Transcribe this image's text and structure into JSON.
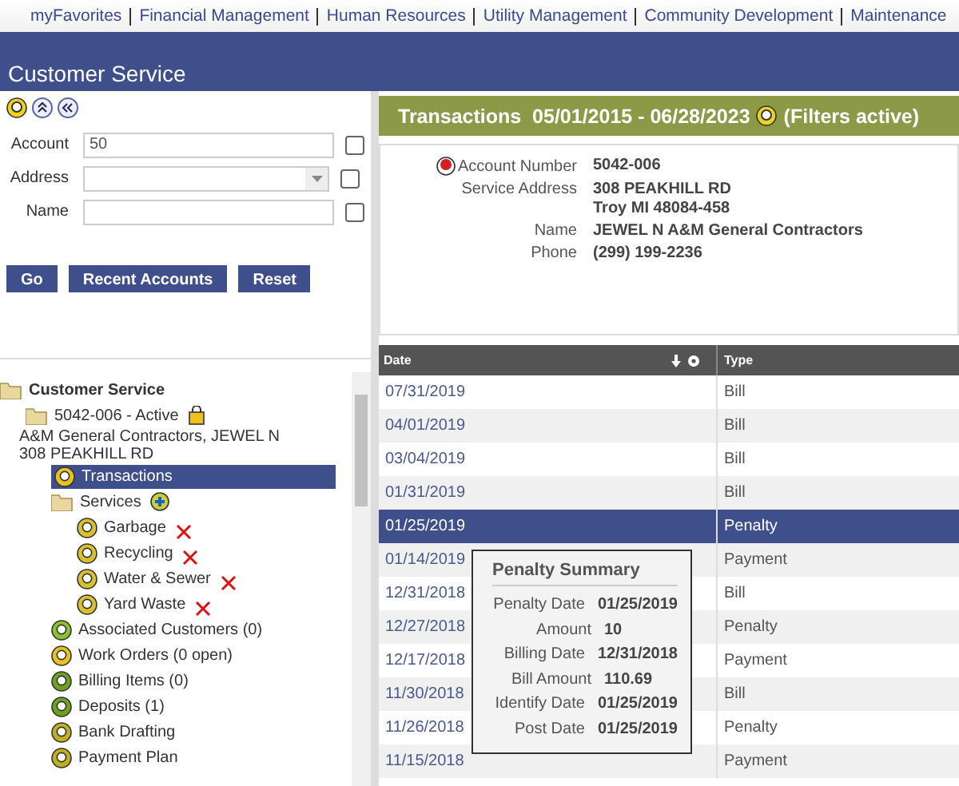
{
  "nav": [
    "myFavorites",
    "Financial Management",
    "Human Resources",
    "Utility Management",
    "Community Development",
    "Maintenance"
  ],
  "header": {
    "title": "Customer Service"
  },
  "search": {
    "fields": [
      {
        "label": "Account",
        "value": "50",
        "kind": "text",
        "checked": false
      },
      {
        "label": "Address",
        "kind": "dropdown",
        "checked": false
      },
      {
        "label": "Name",
        "kind": "text",
        "checked": false
      }
    ],
    "buttons": [
      "Go",
      "Recent Accounts",
      "Reset"
    ]
  },
  "tree": [
    {
      "label": "Customer Service",
      "kind": "folder",
      "selected": false,
      "children": [
        {
          "label": "5042-006 - Active",
          "kind": "account",
          "selected": false,
          "lines": [
            "A&M General Contractors, JEWEL N",
            "308 PEAKHILL RD"
          ],
          "children": [
            {
              "label": "Transactions",
              "kind": "search",
              "selected": true
            },
            {
              "label": "Services",
              "kind": "services",
              "selected": false,
              "children": [
                {
                  "label": "Garbage",
                  "kind": "service",
                  "selected": false,
                  "flagged": true
                },
                {
                  "label": "Recycling",
                  "kind": "service",
                  "selected": false,
                  "flagged": true
                },
                {
                  "label": "Water & Sewer",
                  "kind": "service",
                  "selected": false,
                  "flagged": true
                },
                {
                  "label": "Yard Waste",
                  "kind": "service",
                  "selected": false,
                  "flagged": true
                }
              ]
            },
            {
              "label": "Associated Customers (0)",
              "kind": "people",
              "selected": false
            },
            {
              "label": "Work Orders (0 open)",
              "kind": "search",
              "selected": false
            },
            {
              "label": "Billing Items (0)",
              "kind": "item",
              "selected": false
            },
            {
              "label": "Deposits (1)",
              "kind": "item",
              "selected": false
            },
            {
              "label": "Bank Drafting",
              "kind": "money",
              "selected": false
            },
            {
              "label": "Payment Plan",
              "kind": "money",
              "selected": false
            }
          ]
        }
      ]
    }
  ],
  "panel": {
    "title": "Transactions  05/01/2015 - 06/28/2023",
    "filter_note": "(Filters active)",
    "fields": [
      {
        "label": "Account Number",
        "lines": [
          "5042-006"
        ]
      },
      {
        "label": "Service Address",
        "lines": [
          "308 PEAKHILL RD",
          "Troy MI 48084-458"
        ]
      },
      {
        "label": "Name",
        "lines": [
          "JEWEL N A&M General Contractors"
        ]
      },
      {
        "label": "Phone",
        "lines": [
          "(299) 199-2236"
        ]
      }
    ]
  },
  "table": {
    "columns": [
      "Date",
      "Type"
    ],
    "rows": [
      {
        "date": "07/31/2019",
        "type": "Bill",
        "selected": false
      },
      {
        "date": "04/01/2019",
        "type": "Bill",
        "selected": false
      },
      {
        "date": "03/04/2019",
        "type": "Bill",
        "selected": false
      },
      {
        "date": "01/31/2019",
        "type": "Bill",
        "selected": false
      },
      {
        "date": "01/25/2019",
        "type": "Penalty",
        "selected": true
      },
      {
        "date": "01/14/2019",
        "type": "Payment",
        "selected": false
      },
      {
        "date": "12/31/2018",
        "type": "Bill",
        "selected": false
      },
      {
        "date": "12/27/2018",
        "type": "Penalty",
        "selected": false
      },
      {
        "date": "12/17/2018",
        "type": "Payment",
        "selected": false
      },
      {
        "date": "11/30/2018",
        "type": "Bill",
        "selected": false
      },
      {
        "date": "11/26/2018",
        "type": "Penalty",
        "selected": false
      },
      {
        "date": "11/15/2018",
        "type": "Payment",
        "selected": false
      }
    ]
  },
  "tooltip": {
    "title": "Penalty Summary",
    "fields": [
      {
        "label": "Penalty Date",
        "value": "01/25/2019"
      },
      {
        "label": "Amount",
        "value": "10"
      },
      {
        "label": "Billing Date",
        "value": "12/31/2018"
      },
      {
        "label": "Bill Amount",
        "value": "110.69"
      },
      {
        "label": "Identify Date",
        "value": "01/25/2019"
      },
      {
        "label": "Post Date",
        "value": "01/25/2019"
      }
    ]
  }
}
